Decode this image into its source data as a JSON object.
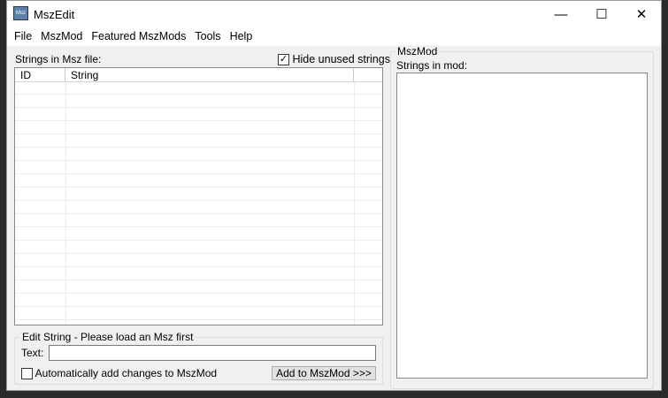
{
  "window": {
    "title": "MszEdit",
    "icon": "Msz"
  },
  "controls": {
    "minimize": "—",
    "maximize": "☐",
    "close": "✕"
  },
  "menu": [
    "File",
    "MszMod",
    "Featured MszMods",
    "Tools",
    "Help"
  ],
  "left": {
    "strings_label": "Strings in Msz file:",
    "hide_unused": {
      "label": "Hide unused strings",
      "checked": true,
      "mark": "✓"
    },
    "columns": [
      "ID",
      "String"
    ]
  },
  "edit": {
    "group_title": "Edit String - Please load an Msz first",
    "text_label": "Text:",
    "text_value": "",
    "auto_add": {
      "label": "Automatically add changes to MszMod",
      "checked": false
    },
    "add_button": "Add to MszMod >>>"
  },
  "right": {
    "group_title": "MszMod",
    "strings_label": "Strings in mod:"
  }
}
